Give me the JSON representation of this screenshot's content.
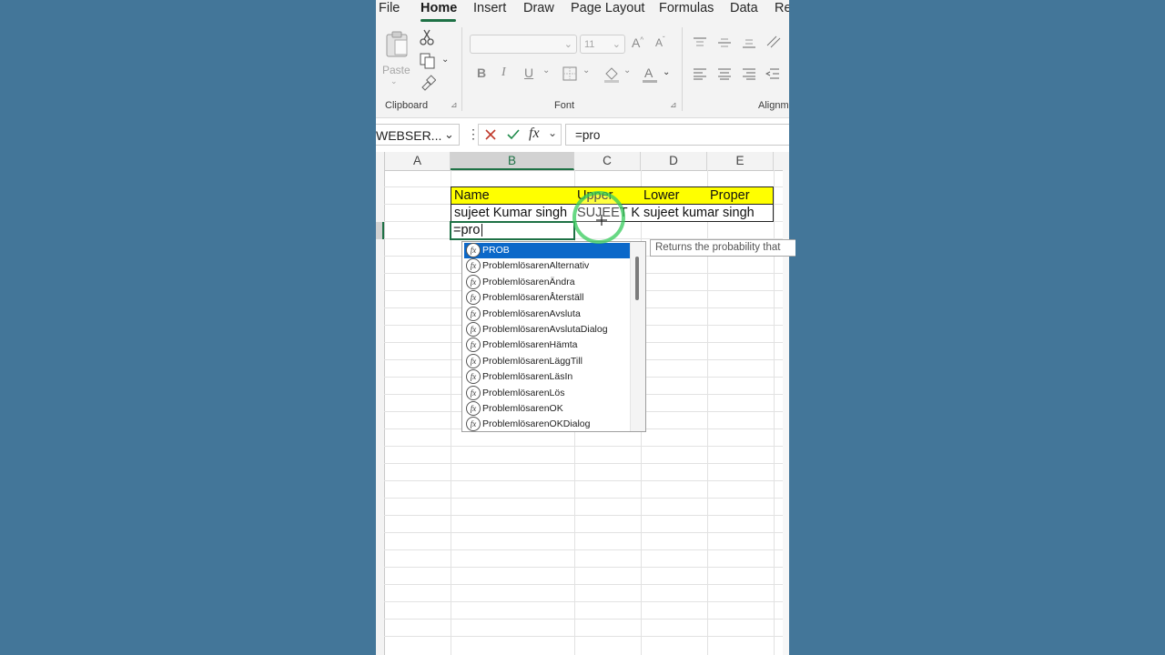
{
  "ribbon": {
    "tabs": [
      "File",
      "Home",
      "Insert",
      "Draw",
      "Page Layout",
      "Formulas",
      "Data",
      "Re"
    ],
    "active_tab": "Home",
    "clipboard": {
      "paste_label": "Paste",
      "group_label": "Clipboard"
    },
    "font": {
      "size_value": "11",
      "group_label": "Font",
      "bold": "B",
      "italic": "I",
      "underline": "U"
    },
    "alignment": {
      "group_label": "Alignm"
    },
    "accent_color": "#1e7145"
  },
  "formula_bar": {
    "name_box": "WEBSER...",
    "fx_label": "fx",
    "formula": "=pro"
  },
  "grid": {
    "column_headers": [
      "A",
      "B",
      "C",
      "D",
      "E"
    ],
    "selected_column": "B",
    "header_row": [
      "Name",
      "Upper",
      "Lower",
      "Proper"
    ],
    "data_row": [
      "sujeet Kumar singh",
      "SUJEET K",
      "sujeet kumar singh",
      ""
    ],
    "editing_cell": "=pro"
  },
  "autocomplete": {
    "items": [
      "PROB",
      "ProblemlösarenAlternativ",
      "ProblemlösarenÄndra",
      "ProblemlösarenÅterställ",
      "ProblemlösarenAvsluta",
      "ProblemlösarenAvslutaDialog",
      "ProblemlösarenHämta",
      "ProblemlösarenLäggTill",
      "ProblemlösarenLäsIn",
      "ProblemlösarenLös",
      "ProblemlösarenOK",
      "ProblemlösarenOKDialog"
    ],
    "selected_index": 0,
    "tooltip": "Returns the probability that"
  }
}
